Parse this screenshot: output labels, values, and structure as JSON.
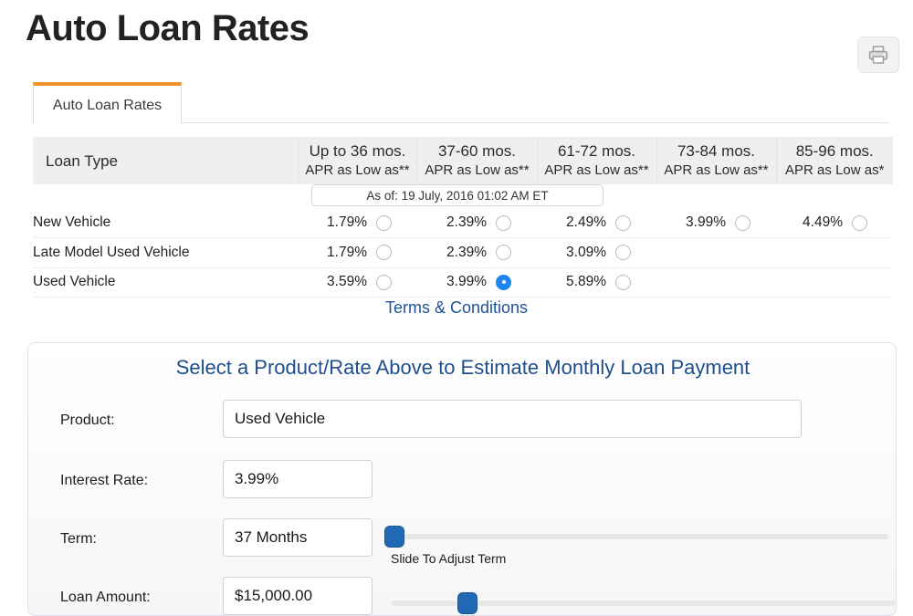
{
  "page": {
    "title": "Auto Loan Rates"
  },
  "toolbar": {
    "print_label": "print-icon"
  },
  "tabs": [
    {
      "label": "Auto Loan Rates",
      "active": true
    }
  ],
  "rates_table": {
    "loan_type_header": "Loan Type",
    "columns": [
      {
        "period": "Up to 36 mos.",
        "apr_note": "APR as Low as**"
      },
      {
        "period": "37-60 mos.",
        "apr_note": "APR as Low as**"
      },
      {
        "period": "61-72 mos.",
        "apr_note": "APR as Low as**"
      },
      {
        "period": "73-84 mos.",
        "apr_note": "APR as Low as**"
      },
      {
        "period": "85-96 mos.",
        "apr_note": "APR as Low as*"
      }
    ],
    "as_of": "As of: 19 July, 2016 01:02 AM ET",
    "rows": [
      {
        "loan_type": "New Vehicle",
        "rates": [
          "1.79%",
          "2.39%",
          "2.49%",
          "3.99%",
          "4.49%"
        ],
        "selected_index": -1
      },
      {
        "loan_type": "Late Model Used Vehicle",
        "rates": [
          "1.79%",
          "2.39%",
          "3.09%",
          "",
          ""
        ],
        "selected_index": -1
      },
      {
        "loan_type": "Used Vehicle",
        "rates": [
          "3.59%",
          "3.99%",
          "5.89%",
          "",
          ""
        ],
        "selected_index": 1
      }
    ]
  },
  "terms_link": "Terms & Conditions",
  "calculator": {
    "heading": "Select a Product/Rate Above to Estimate Monthly Loan Payment",
    "fields": {
      "product": {
        "label": "Product:",
        "value": "Used Vehicle"
      },
      "interest_rate": {
        "label": "Interest Rate:",
        "value": "3.99%"
      },
      "term": {
        "label": "Term:",
        "value": "37 Months",
        "slider_caption": "Slide To Adjust Term"
      },
      "loan_amount": {
        "label": "Loan Amount:",
        "value": "$15,000.00"
      }
    }
  },
  "colors": {
    "tab_accent": "#f0922b",
    "link_blue": "#20519c",
    "heading_blue": "#1f4e8c",
    "radio_selected": "#1d87ef",
    "slider_handle": "#2069b5",
    "header_bg": "#edeff1"
  }
}
